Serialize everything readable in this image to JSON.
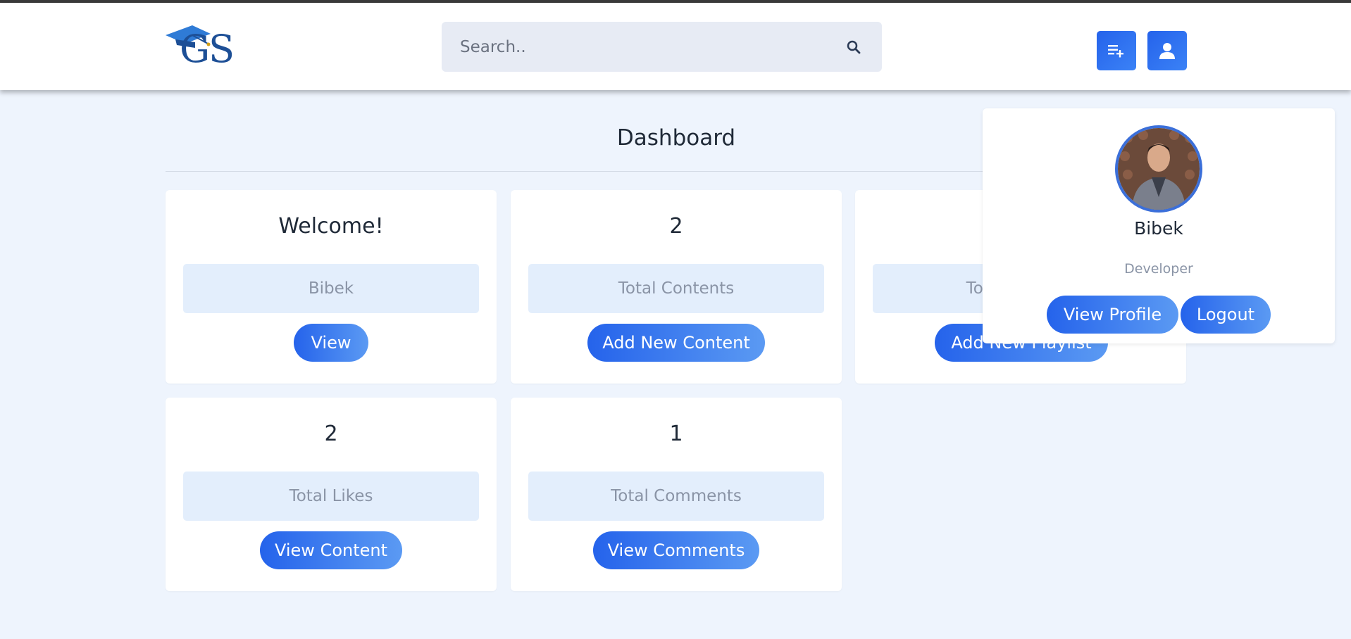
{
  "header": {
    "logo_text": "GS",
    "search_placeholder": "Search.."
  },
  "dashboard": {
    "title": "Dashboard",
    "cards": [
      {
        "value": "Welcome!",
        "label": "Bibek",
        "button": "View"
      },
      {
        "value": "2",
        "label": "Total Contents",
        "button": "Add New Content"
      },
      {
        "value": "",
        "label": "Total Playlists",
        "button": "Add New Playlist"
      },
      {
        "value": "2",
        "label": "Total Likes",
        "button": "View Content"
      },
      {
        "value": "1",
        "label": "Total Comments",
        "button": "View Comments"
      }
    ]
  },
  "profile_popup": {
    "name": "Bibek",
    "role": "Developer",
    "view_profile": "View Profile",
    "logout": "Logout"
  },
  "colors": {
    "accent": "#2563eb",
    "background": "#eef4fd"
  }
}
